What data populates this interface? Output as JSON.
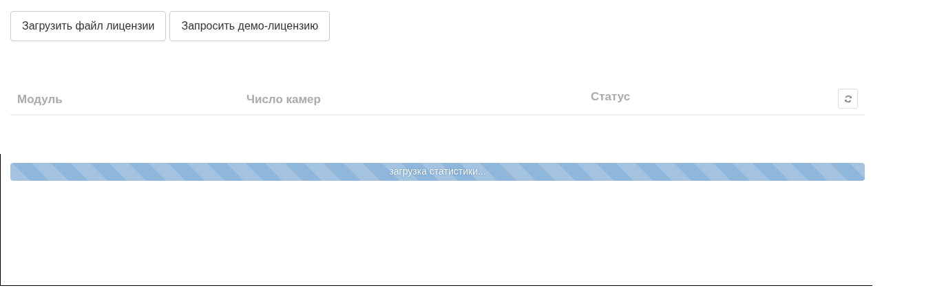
{
  "buttons": [
    "Загрузить файл лицензии",
    "Запросить демо-лицензию"
  ],
  "table": {
    "columns": [
      "Модуль",
      "Число камер",
      "Статус"
    ]
  },
  "progress": {
    "label": "загрузка статистики...",
    "level": 1
  }
}
